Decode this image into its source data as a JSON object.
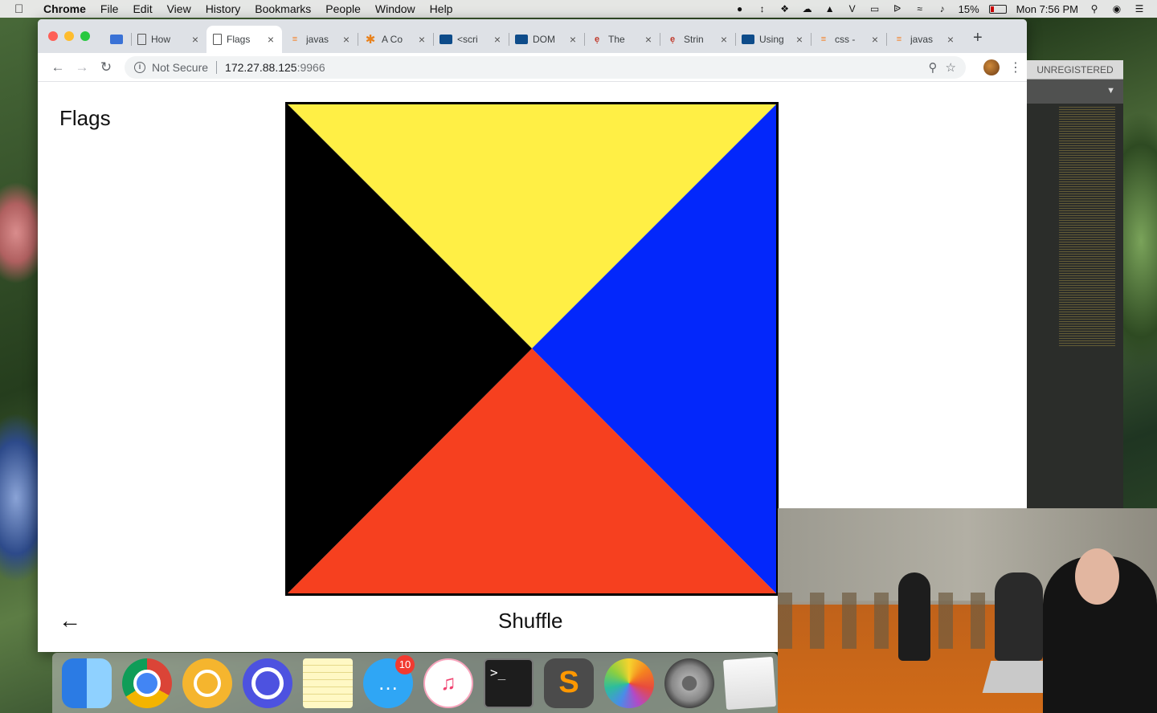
{
  "menubar": {
    "app_name": "Chrome",
    "items": [
      "File",
      "Edit",
      "View",
      "History",
      "Bookmarks",
      "People",
      "Window",
      "Help"
    ],
    "battery": "15%",
    "clock": "Mon 7:56 PM"
  },
  "browser": {
    "tabs": [
      {
        "title": "How",
        "icon": "doc-icon"
      },
      {
        "title": "Flags",
        "icon": "doc-icon",
        "active": true
      },
      {
        "title": "javas",
        "icon": "stackoverflow-icon"
      },
      {
        "title": "A Co",
        "icon": "asterisk-icon"
      },
      {
        "title": "<scri",
        "icon": "mdn-icon"
      },
      {
        "title": "DOM",
        "icon": "mdn-icon"
      },
      {
        "title": "The",
        "icon": "w3-icon"
      },
      {
        "title": "Strin",
        "icon": "w3-icon"
      },
      {
        "title": "Using",
        "icon": "mdn-icon"
      },
      {
        "title": "css -",
        "icon": "stackoverflow-icon"
      },
      {
        "title": "javas",
        "icon": "stackoverflow-icon"
      }
    ],
    "address": {
      "security_label": "Not Secure",
      "host": "172.27.88.125",
      "port": ":9966"
    }
  },
  "page": {
    "title": "Flags",
    "shuffle_label": "Shuffle",
    "back_glyph": "←",
    "flag_colors": {
      "top": "#ffef45",
      "right": "#0327fb",
      "bottom": "#f6401f",
      "left": "#000000"
    }
  },
  "editor": {
    "unregistered_label": "UNREGISTERED"
  },
  "dock": {
    "apps": [
      "Finder",
      "Chrome",
      "Chrome Canary",
      "Quicksilver",
      "Notes",
      "Messages",
      "iTunes",
      "Terminal",
      "Sublime Text",
      "Photos",
      "System Preferences",
      "TextEdit"
    ],
    "messages_badge": "10"
  }
}
